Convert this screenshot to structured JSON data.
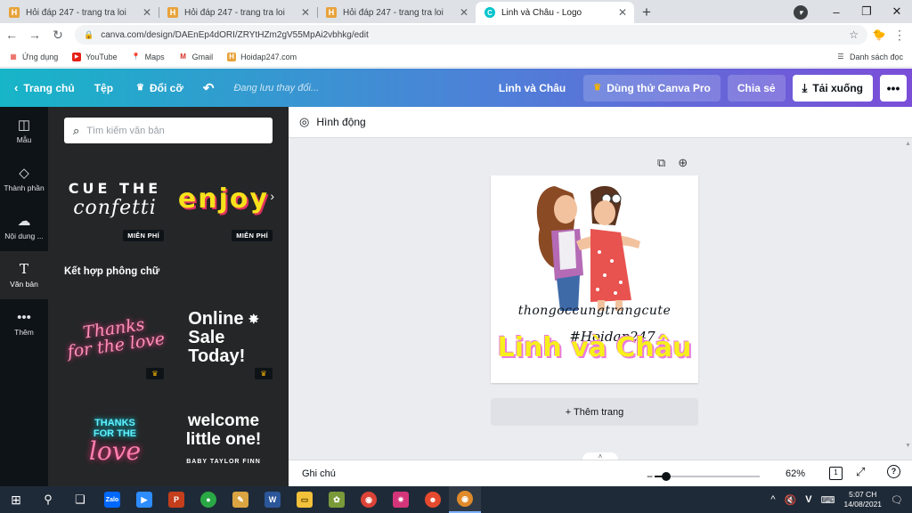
{
  "browser": {
    "tabs": [
      {
        "title": "Hỏi đáp 247 - trang tra loi",
        "favicon": "H"
      },
      {
        "title": "Hỏi đáp 247 - trang tra loi",
        "favicon": "H"
      },
      {
        "title": "Hỏi đáp 247 - trang tra loi",
        "favicon": "H"
      },
      {
        "title": "Linh và Châu - Logo",
        "favicon": "C"
      }
    ],
    "url": "canva.com/design/DAEnEp4dORI/ZRYtHZm2gV55MpAi2vbhkg/edit",
    "bookmarks": [
      {
        "label": "Ứng dụng",
        "icon": "apps-icon"
      },
      {
        "label": "YouTube",
        "icon": "youtube-icon"
      },
      {
        "label": "Maps",
        "icon": "maps-icon"
      },
      {
        "label": "Gmail",
        "icon": "gmail-icon"
      },
      {
        "label": "Hoidap247.com",
        "icon": "hoidap-icon"
      }
    ],
    "reading_list": "Danh sách đọc"
  },
  "header": {
    "home": "Trang chủ",
    "file": "Tệp",
    "resize": "Đổi cỡ",
    "status": "Đang lưu thay đổi...",
    "design_title": "Linh và Châu",
    "try_pro": "Dùng thử Canva Pro",
    "share": "Chia sẻ",
    "download": "Tải xuống"
  },
  "rail": [
    {
      "label": "Mẫu",
      "icon": "templates-icon"
    },
    {
      "label": "Thành phần",
      "icon": "elements-icon"
    },
    {
      "label": "Nội dung ...",
      "icon": "uploads-icon"
    },
    {
      "label": "Văn bản",
      "icon": "text-icon"
    },
    {
      "label": "Thêm",
      "icon": "more-icon"
    }
  ],
  "panel": {
    "search_placeholder": "Tìm kiếm văn bản",
    "free_badge": "MIỄN PHÍ",
    "section_title": "Kết hợp phông chữ",
    "samples": {
      "cue_line1": "CUE THE",
      "cue_line2": "confetti",
      "enjoy": "enjoy",
      "thanks_line1": "Thanks",
      "thanks_line2": "for the love",
      "online_line1": "Online",
      "online_line2": "Sale",
      "online_line3": "Today!",
      "thanks2_line1": "THANKS",
      "thanks2_line2": "FOR THE",
      "thanks2_line3": "love",
      "welcome_line1": "welcome",
      "welcome_line2": "little one!",
      "welcome_line3": "BABY TAYLOR FINN"
    }
  },
  "editor": {
    "animate": "Hình động",
    "design_text": {
      "tagline": "thongoccungtrangcute",
      "hashtag": "#Hoidap247",
      "main": "Linh và Châu"
    },
    "add_page": "+ Thêm trang",
    "notes": "Ghi chú",
    "zoom_percent": 62,
    "zoom": "62%",
    "page_count": "1"
  },
  "taskbar": {
    "time": "5:07 CH",
    "date": "14/08/2021"
  },
  "colors": {
    "canva_gradient_start": "#17b5c8",
    "canva_gradient_end": "#7b4ed8",
    "panel_bg": "#252627",
    "rail_bg": "#0e1318",
    "logo_yellow": "#f7f01c",
    "logo_pink": "#ea79e0"
  }
}
